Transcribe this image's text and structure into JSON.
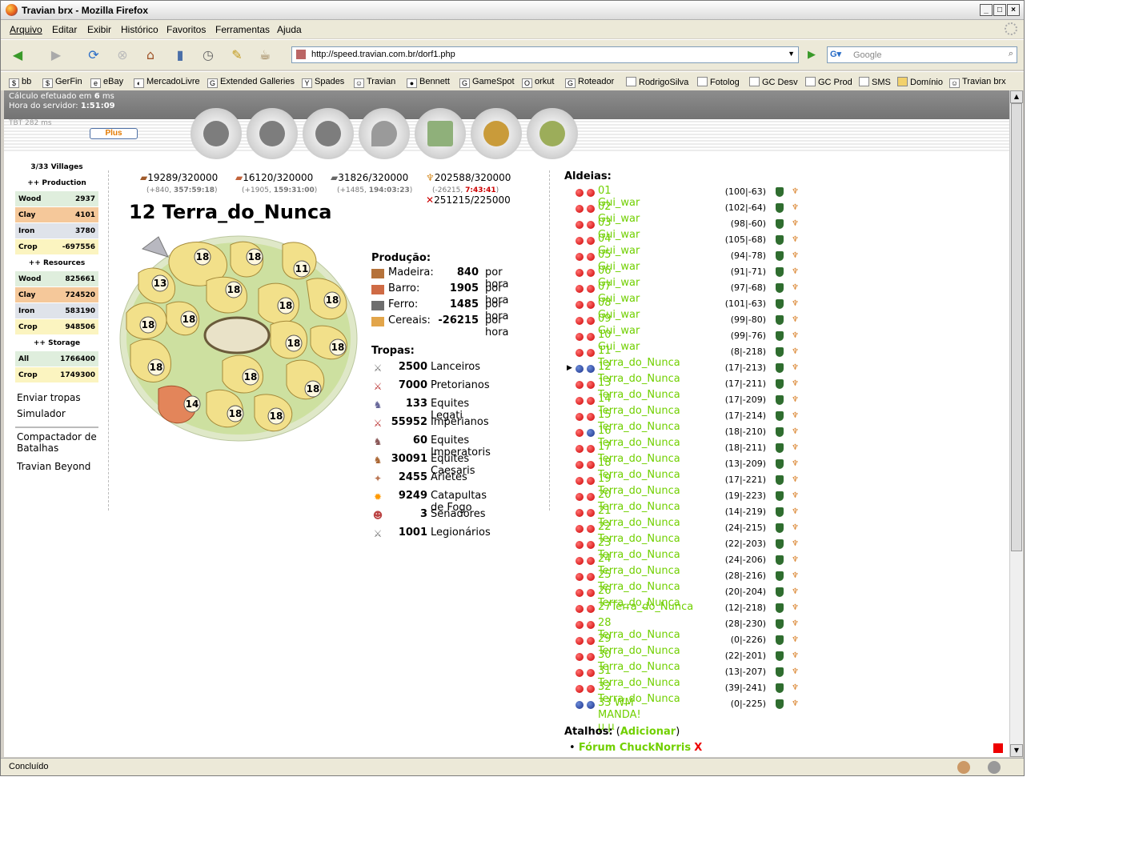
{
  "window": {
    "title": "Travian brx - Mozilla Firefox"
  },
  "menu": [
    "Arquivo",
    "Editar",
    "Exibir",
    "Histórico",
    "Favoritos",
    "Ferramentas",
    "Ajuda"
  ],
  "url": "http://speed.travian.com.br/dorf1.php",
  "search_placeholder": "Google",
  "bookmarks": [
    "bb",
    "GerFin",
    "eBay",
    "MercadoLivre",
    "Extended Galleries",
    "Spades",
    "Travian",
    "Bennett",
    "GameSpot",
    "orkut",
    "Roteador",
    "RodrigoSilva",
    "Fotolog",
    "GC Desv",
    "GC Prod",
    "SMS",
    "Domínio",
    "Travian brx"
  ],
  "status_text": "Concluído",
  "header": {
    "calc_prefix": "Cálculo efetuado em ",
    "calc_ms": "6",
    "calc_suffix": " ms",
    "server_prefix": "Hora do servidor: ",
    "server_time": "1:51:09",
    "tbt": "TBT 282 ms",
    "plus": "Plus"
  },
  "left": {
    "villages": "3/33 Villages",
    "production_title": "++ Production",
    "production": [
      {
        "k": "Wood",
        "v": "2937"
      },
      {
        "k": "Clay",
        "v": "4101"
      },
      {
        "k": "Iron",
        "v": "3780"
      },
      {
        "k": "Crop",
        "v": "-697556"
      }
    ],
    "resources_title": "++ Resources",
    "resources": [
      {
        "k": "Wood",
        "v": "825661"
      },
      {
        "k": "Clay",
        "v": "724520"
      },
      {
        "k": "Iron",
        "v": "583190"
      },
      {
        "k": "Crop",
        "v": "948506"
      }
    ],
    "storage_title": "++ Storage",
    "storage": [
      {
        "k": "All",
        "v": "1766400"
      },
      {
        "k": "Crop",
        "v": "1749300"
      }
    ],
    "links1": [
      "Enviar tropas",
      "Simulador"
    ],
    "links2": [
      "Compactador de Batalhas",
      "Travian Beyond"
    ]
  },
  "resources": [
    {
      "val": "19289/320000",
      "sub1": "(+840, ",
      "sub2": "357:59:18",
      ")": ")"
    },
    {
      "val": "16120/320000",
      "sub1": "(+1905, ",
      "sub2": "159:31:00"
    },
    {
      "val": "31826/320000",
      "sub1": "(+1485, ",
      "sub2": "194:03:23"
    },
    {
      "val": "202588/320000",
      "sub1": "(-26215, ",
      "sub2": "7:43:41"
    }
  ],
  "consumption": "251215/225000",
  "village_name": "12 Terra_do_Nunca",
  "fields": [
    "18",
    "18",
    "11",
    "13",
    "18",
    "18",
    "18",
    "18",
    "18",
    "18",
    "18",
    "18",
    "18",
    "18",
    "14",
    "18",
    "18"
  ],
  "production": {
    "title": "Produção:",
    "rows": [
      {
        "n": "Madeira:",
        "v": "840",
        "u": "por hora"
      },
      {
        "n": "Barro:",
        "v": "1905",
        "u": "por hora"
      },
      {
        "n": "Ferro:",
        "v": "1485",
        "u": "por hora"
      },
      {
        "n": "Cereais:",
        "v": "-26215",
        "u": "por hora"
      }
    ]
  },
  "troops": {
    "title": "Tropas:",
    "rows": [
      {
        "v": "2500",
        "n": "Lanceiros"
      },
      {
        "v": "7000",
        "n": "Pretorianos"
      },
      {
        "v": "133",
        "n": "Equites Legati"
      },
      {
        "v": "55952",
        "n": "Imperianos"
      },
      {
        "v": "60",
        "n": "Equites Imperatoris"
      },
      {
        "v": "30091",
        "n": "Equites Caesaris"
      },
      {
        "v": "2455",
        "n": "Aríetes"
      },
      {
        "v": "9249",
        "n": "Catapultas de Fogo"
      },
      {
        "v": "3",
        "n": "Senadores"
      },
      {
        "v": "1001",
        "n": "Legionários"
      }
    ]
  },
  "villages_title": "Aldeias:",
  "villages": [
    {
      "n": "01 Gui_war",
      "c": "(100|-63)",
      "d": "rr"
    },
    {
      "n": "02 Gui_war",
      "c": "(102|-64)",
      "d": "rr"
    },
    {
      "n": "03 Gui_war",
      "c": "(98|-60)",
      "d": "rr"
    },
    {
      "n": "04 Gui_war",
      "c": "(105|-68)",
      "d": "rr"
    },
    {
      "n": "05 Gui_war",
      "c": "(94|-78)",
      "d": "rr"
    },
    {
      "n": "06 Gui_war",
      "c": "(91|-71)",
      "d": "rr"
    },
    {
      "n": "07 Gui_war",
      "c": "(97|-68)",
      "d": "rr"
    },
    {
      "n": "08 Gui_war",
      "c": "(101|-63)",
      "d": "rr"
    },
    {
      "n": "09 Gui_war",
      "c": "(99|-80)",
      "d": "rr"
    },
    {
      "n": "10 Gui_war",
      "c": "(99|-76)",
      "d": "rr"
    },
    {
      "n": "11 Terra_do_Nunca",
      "c": "(8|-218)",
      "d": "rr"
    },
    {
      "n": "12 Terra_do_Nunca",
      "c": "(17|-213)",
      "d": "bb",
      "cur": true
    },
    {
      "n": "13 Terra_do_Nunca",
      "c": "(17|-211)",
      "d": "rr"
    },
    {
      "n": "14 Terra_do_Nunca",
      "c": "(17|-209)",
      "d": "rr"
    },
    {
      "n": "15 Terra_do_Nunca",
      "c": "(17|-214)",
      "d": "rr"
    },
    {
      "n": "16 Terra_do_Nunca",
      "c": "(18|-210)",
      "d": "rb"
    },
    {
      "n": "17 Terra_do_Nunca",
      "c": "(18|-211)",
      "d": "rr"
    },
    {
      "n": "18 Terra_do_Nunca",
      "c": "(13|-209)",
      "d": "rr"
    },
    {
      "n": "19 Terra_do_Nunca",
      "c": "(17|-221)",
      "d": "rr"
    },
    {
      "n": "20 Terra_do_Nunca",
      "c": "(19|-223)",
      "d": "rr"
    },
    {
      "n": "21 Terra_do_Nunca",
      "c": "(14|-219)",
      "d": "rr"
    },
    {
      "n": "22 Terra_do_Nunca",
      "c": "(24|-215)",
      "d": "rr"
    },
    {
      "n": "23 Terra_do_Nunca",
      "c": "(22|-203)",
      "d": "rr"
    },
    {
      "n": "24 Terra_do_Nunca",
      "c": "(24|-206)",
      "d": "rr"
    },
    {
      "n": "25 Terra_do_Nunca",
      "c": "(28|-216)",
      "d": "rr"
    },
    {
      "n": "26 Terra_do_Nunca",
      "c": "(20|-204)",
      "d": "rr"
    },
    {
      "n": "27Terra_do_Nunca",
      "c": "(12|-218)",
      "d": "rr"
    },
    {
      "n": "28 Terra_do_Nunca",
      "c": "(28|-230)",
      "d": "rr"
    },
    {
      "n": "29 Terra_do_Nunca",
      "c": "(0|-226)",
      "d": "rr"
    },
    {
      "n": "30 Terra_do_Nunca",
      "c": "(22|-201)",
      "d": "rr"
    },
    {
      "n": "31 Terra_do_Nunca",
      "c": "(13|-207)",
      "d": "rr"
    },
    {
      "n": "32 Terra_do_Nunca",
      "c": "(39|-241)",
      "d": "rr"
    },
    {
      "n": "33 WM MANDA! µ µ",
      "c": "(0|-225)",
      "d": "bb"
    }
  ],
  "shortcuts": {
    "title": "Atalhos:",
    "open": "(",
    "add": "Adicionar",
    "close": ")",
    "item": "Fórum ChuckNorris",
    "remove": "X"
  }
}
